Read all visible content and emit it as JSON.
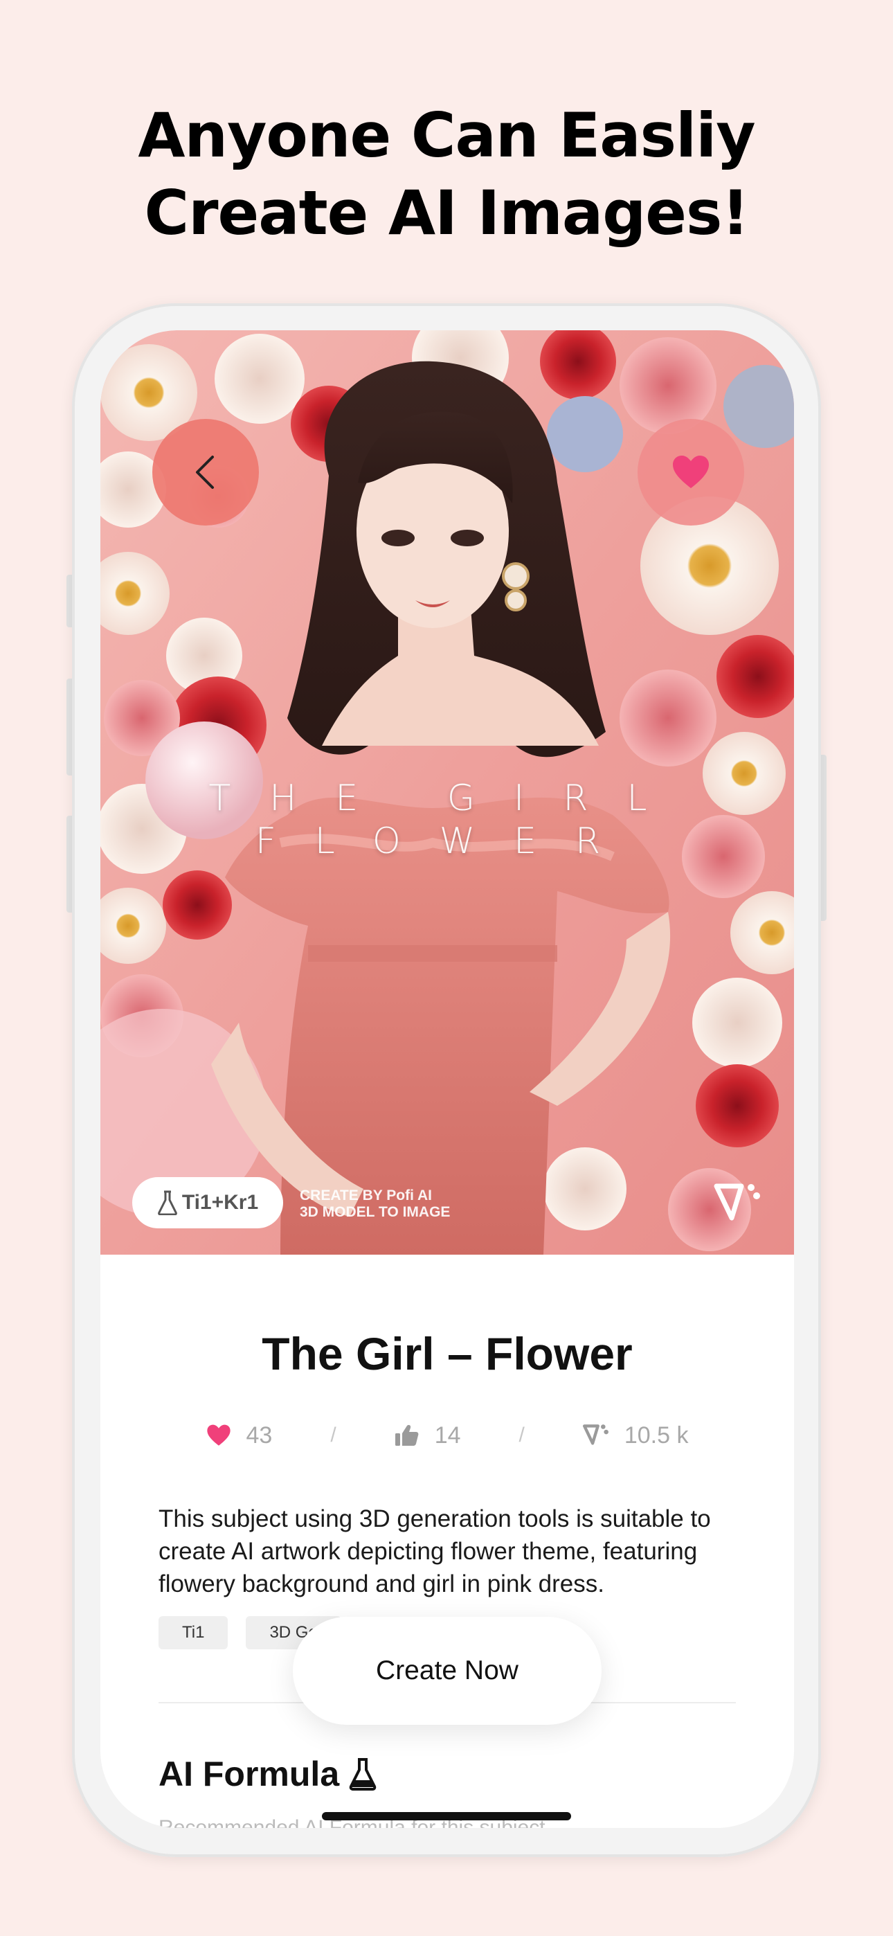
{
  "headline": {
    "line1": "Anyone Can Easliy",
    "line2": "Create AI Images!"
  },
  "hero": {
    "poster_title_line1": "THE GIRL",
    "poster_title_line2": "FLOWER",
    "back_icon": "chevron-left-icon",
    "favorite_icon": "heart-icon",
    "formula_chip_label": "Ti1+Kr1",
    "formula_icon": "flask-icon",
    "credit_line1": "CREATE BY Pofi AI",
    "credit_line2": "3D MODEL TO IMAGE",
    "brand_icon": "pofi-logo-icon"
  },
  "details": {
    "title": "The Girl – Flower",
    "stats": {
      "likes": "43",
      "thumbs": "14",
      "views": "10.5 k"
    },
    "description": "This subject using 3D generation tools is suitable to create AI artwork depicting flower theme, featuring flowery background and girl in pink dress.",
    "tags": [
      "Ti1",
      "3D Ge"
    ],
    "create_button": "Create Now",
    "section_title": "AI Formula",
    "section_subtitle": "Recommended AI Formula for this subject"
  },
  "colors": {
    "background": "#fcedea",
    "accent_pink": "#f0407a",
    "button_coral": "#ee7870"
  }
}
